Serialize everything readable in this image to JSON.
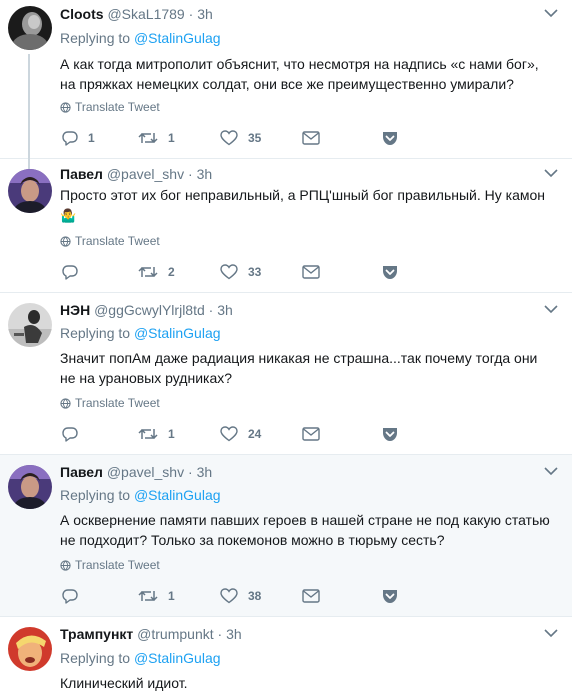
{
  "tweets": [
    {
      "name": "Cloots",
      "handle": "@SkaL1789",
      "time": "3h",
      "reply_prefix": "Replying to",
      "reply_to": "@StalinGulag",
      "text": "А как тогда митрополит объяснит, что несмотря на надпись «с нами бог», на пряжках немецких солдат, они все же преимущественно умирали?",
      "translate": "Translate Tweet",
      "replies": "1",
      "retweets": "1",
      "likes": "35"
    },
    {
      "name": "Павел",
      "handle": "@pavel_shv",
      "time": "3h",
      "text": "Просто этот их бог неправильный, а РПЦ'шный бог правильный. Ну камон",
      "emoji": "🤷‍♂️",
      "translate": "Translate Tweet",
      "replies": "",
      "retweets": "2",
      "likes": "33"
    },
    {
      "name": "НЭН",
      "handle": "@ggGcwylYlrjl8td",
      "time": "3h",
      "reply_prefix": "Replying to",
      "reply_to": "@StalinGulag",
      "text": "Значит попАм даже радиация никакая не страшна...так почему тогда они не на урановых рудниках?",
      "translate": "Translate Tweet",
      "replies": "",
      "retweets": "1",
      "likes": "24"
    },
    {
      "name": "Павел",
      "handle": "@pavel_shv",
      "time": "3h",
      "reply_prefix": "Replying to",
      "reply_to": "@StalinGulag",
      "text": "А осквернение памяти павших героев в нашей стране не под какую статью не подходит? Только за покемонов можно в тюрьму сесть?",
      "translate": "Translate Tweet",
      "replies": "",
      "retweets": "1",
      "likes": "38"
    },
    {
      "name": "Трампункт",
      "handle": "@trumpunkt",
      "time": "3h",
      "reply_prefix": "Replying to",
      "reply_to": "@StalinGulag",
      "text": "Клинический идиот."
    }
  ],
  "separator": "·",
  "colors": {
    "link": "#1da1f2",
    "muted": "#657786",
    "text": "#14171a",
    "alt_bg": "#f5f8fa",
    "thread_line": "#ccd6dd"
  },
  "icons": [
    "reply-icon",
    "retweet-icon",
    "heart-icon",
    "envelope-icon",
    "pocket-icon",
    "globe-icon",
    "chevron-down-icon"
  ]
}
